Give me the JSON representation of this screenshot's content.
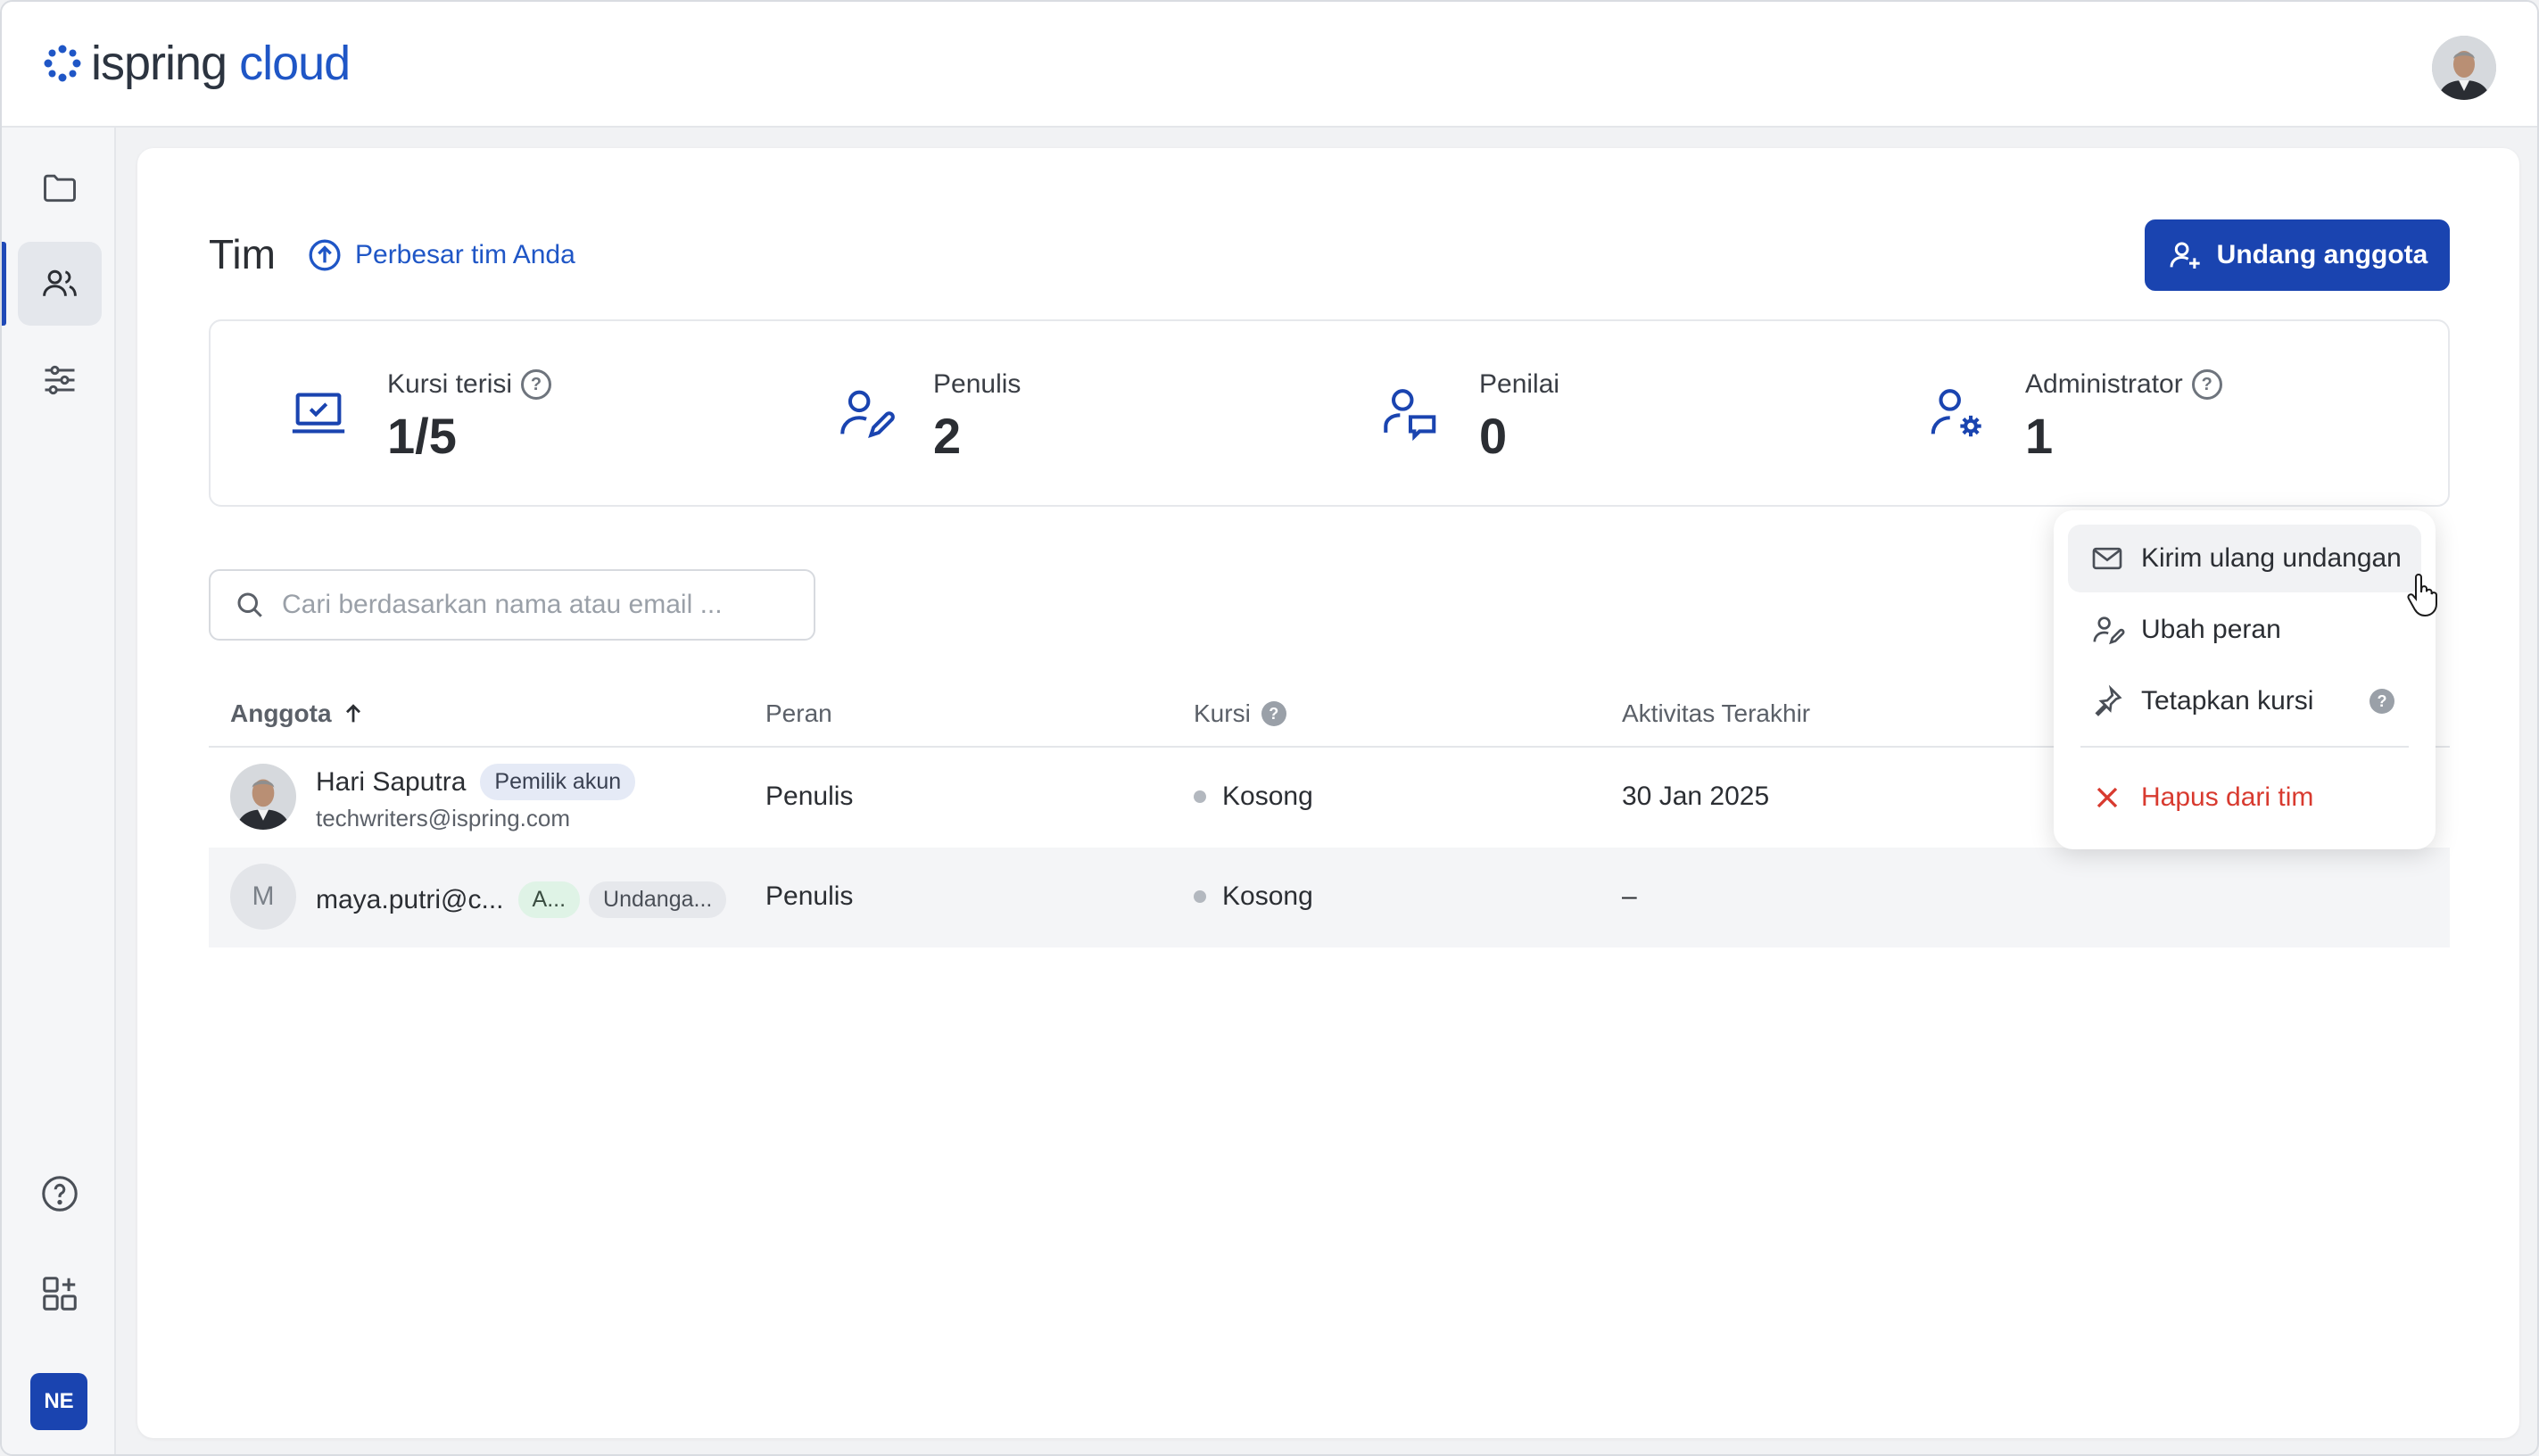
{
  "app": {
    "logo_word": "ispring",
    "logo_suffix": "cloud"
  },
  "sidebar": {
    "items": [
      {
        "icon": "folder-icon"
      },
      {
        "icon": "users-icon",
        "active": true
      },
      {
        "icon": "sliders-icon"
      },
      {
        "icon": "help-icon"
      },
      {
        "icon": "apps-add-icon"
      }
    ],
    "account_initials": "NE"
  },
  "header": {
    "title": "Tim",
    "grow_link": "Perbesar tim Anda",
    "invite_button": "Undang anggota"
  },
  "stats": [
    {
      "label": "Kursi terisi",
      "value": "1/5",
      "help": true,
      "icon": "laptop-check-icon"
    },
    {
      "label": "Penulis",
      "value": "2",
      "help": false,
      "icon": "user-edit-icon"
    },
    {
      "label": "Penilai",
      "value": "0",
      "help": false,
      "icon": "user-review-icon"
    },
    {
      "label": "Administrator",
      "value": "1",
      "help": true,
      "icon": "user-settings-icon"
    }
  ],
  "search": {
    "placeholder": "Cari berdasarkan nama atau email ..."
  },
  "table": {
    "columns": {
      "member": "Anggota",
      "role": "Peran",
      "seat": "Kursi",
      "last_activity": "Aktivitas Terakhir"
    },
    "rows": [
      {
        "name": "Hari Saputra",
        "badge": "Pemilik akun",
        "email": "techwriters@ispring.com",
        "role": "Penulis",
        "seat": "Kosong",
        "last_activity": "30 Jan 2025"
      },
      {
        "initial": "M",
        "name": "maya.putri@c...",
        "badge_a": "A...",
        "badge_b": "Undanga...",
        "role": "Penulis",
        "seat": "Kosong",
        "last_activity": "–"
      }
    ]
  },
  "context_menu": {
    "resend": "Kirim ulang undangan",
    "change_role": "Ubah peran",
    "assign_seat": "Tetapkan kursi",
    "remove": "Hapus dari tim"
  },
  "colors": {
    "brand": "#1a44b0",
    "link": "#1f56c6",
    "danger": "#d83a2f"
  }
}
